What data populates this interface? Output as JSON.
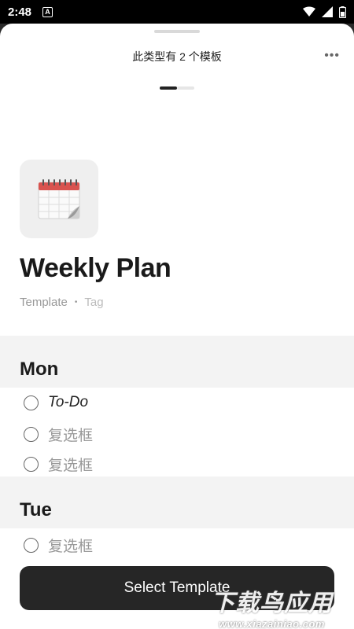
{
  "status_bar": {
    "time": "2:48",
    "notification_letter": "A",
    "icons": [
      "wifi-icon",
      "signal-icon",
      "battery-icon"
    ]
  },
  "sheet": {
    "header_title": "此类型有 2 个模板",
    "more_icon": "more-icon",
    "pager": {
      "total": 2,
      "active": 1
    }
  },
  "template": {
    "icon": "calendar-icon",
    "title": "Weekly Plan",
    "type_label": "Template",
    "separator": "•",
    "tag_label": "Tag"
  },
  "days": [
    {
      "name": "Mon",
      "items": [
        {
          "label": "To-Do",
          "style": "todo"
        },
        {
          "label": "复选框",
          "style": "placeholder"
        },
        {
          "label": "复选框",
          "style": "placeholder"
        }
      ]
    },
    {
      "name": "Tue",
      "items": [
        {
          "label": "复选框",
          "style": "placeholder"
        }
      ]
    }
  ],
  "select_button_label": "Select Template",
  "watermark": {
    "text": "下载鸟应用",
    "url": "www.xiazainiao.com"
  },
  "colors": {
    "button_bg": "#262626",
    "section_bg": "#f3f3f3",
    "muted_text": "#999999"
  }
}
